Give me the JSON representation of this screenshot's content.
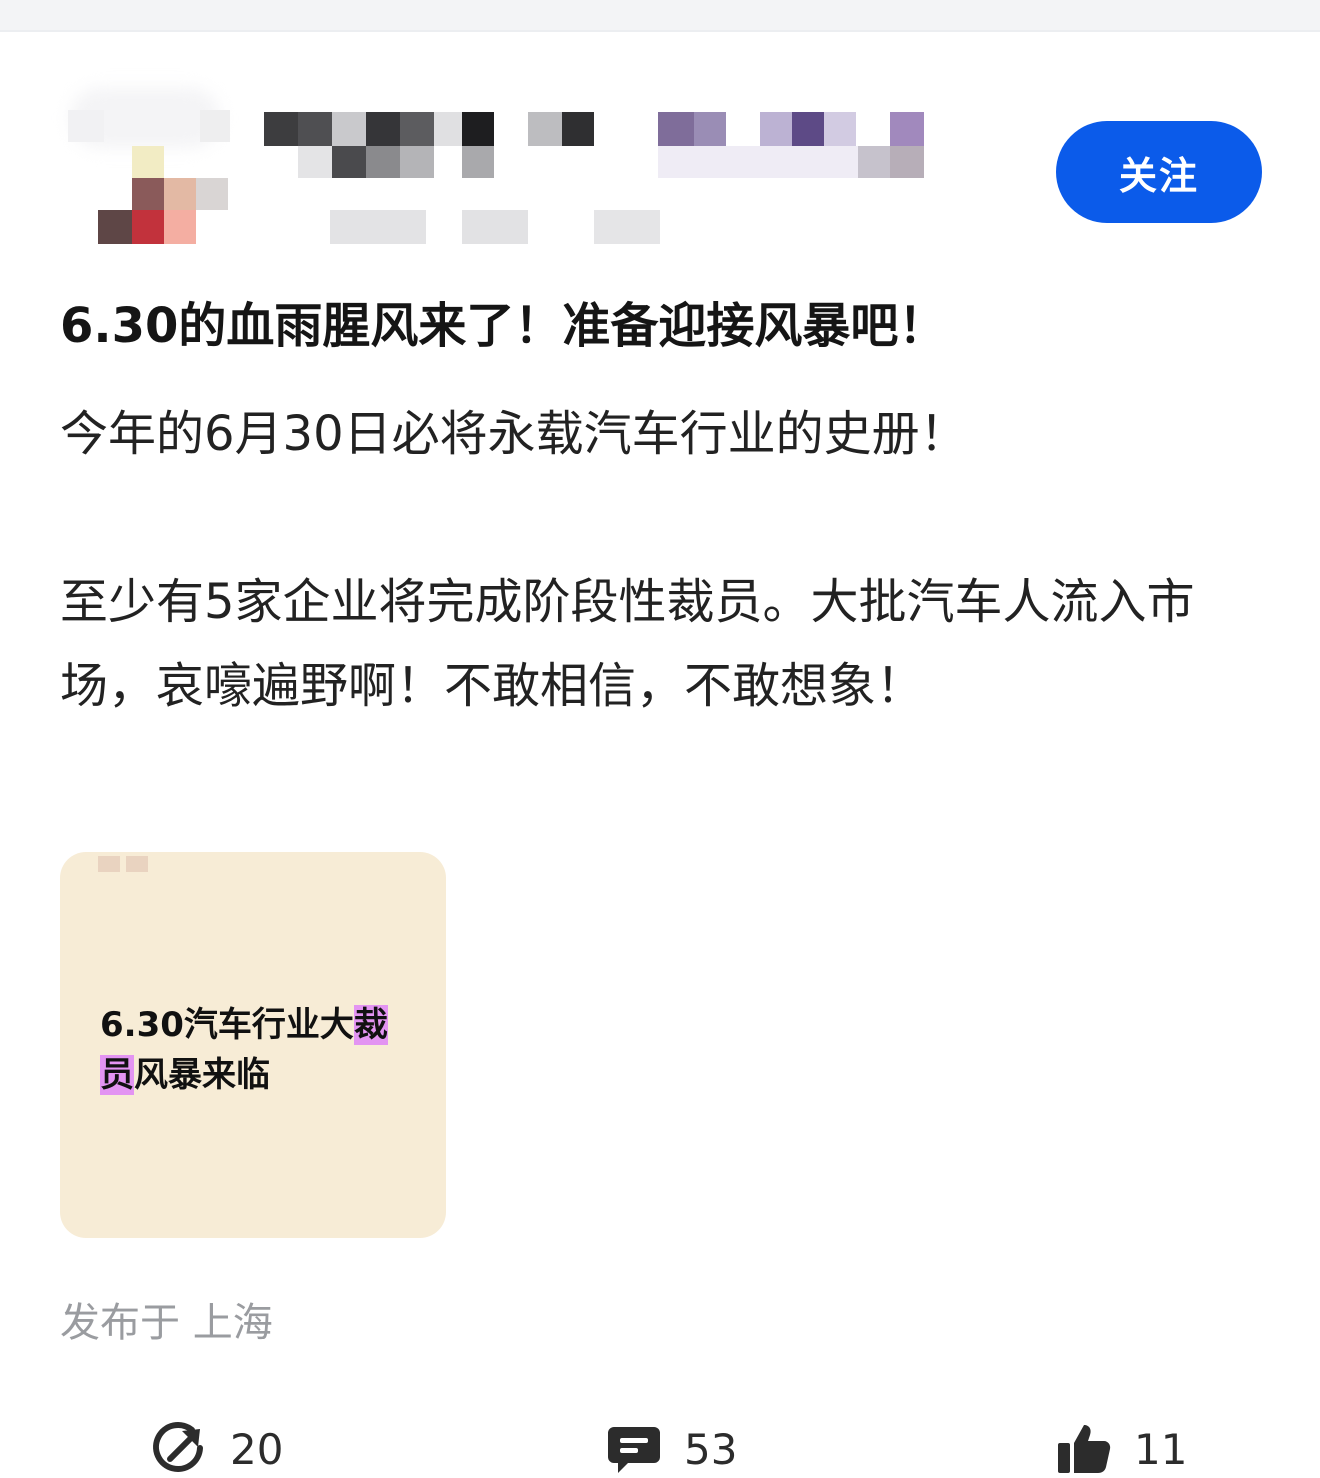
{
  "header": {
    "follow_label": "关注"
  },
  "post": {
    "title": "6.30的血雨腥风来了！准备迎接风暴吧！",
    "paragraph1": "今年的6月30日必将永载汽车行业的史册！",
    "paragraph2": "至少有5家企业将完成阶段性裁员。大批汽车人流入市场，哀嚎遍野啊！不敢相信，不敢想象！",
    "image_text_plain": "6.30汽车行业大",
    "image_text_hl1": "裁",
    "image_text_hl2": "员",
    "image_text_rest": "风暴来临",
    "location": "发布于 上海"
  },
  "actions": {
    "share_count": "20",
    "comment_count": "53",
    "like_count": "11"
  },
  "icons": {
    "share": "share-arrow-icon",
    "comment": "comment-bubble-icon",
    "like": "thumbs-up-icon"
  },
  "colors": {
    "accent": "#0b5bea",
    "highlight": "#e394f2",
    "thumb_bg": "#f7ecd6",
    "muted_text": "#9a9ca0"
  }
}
